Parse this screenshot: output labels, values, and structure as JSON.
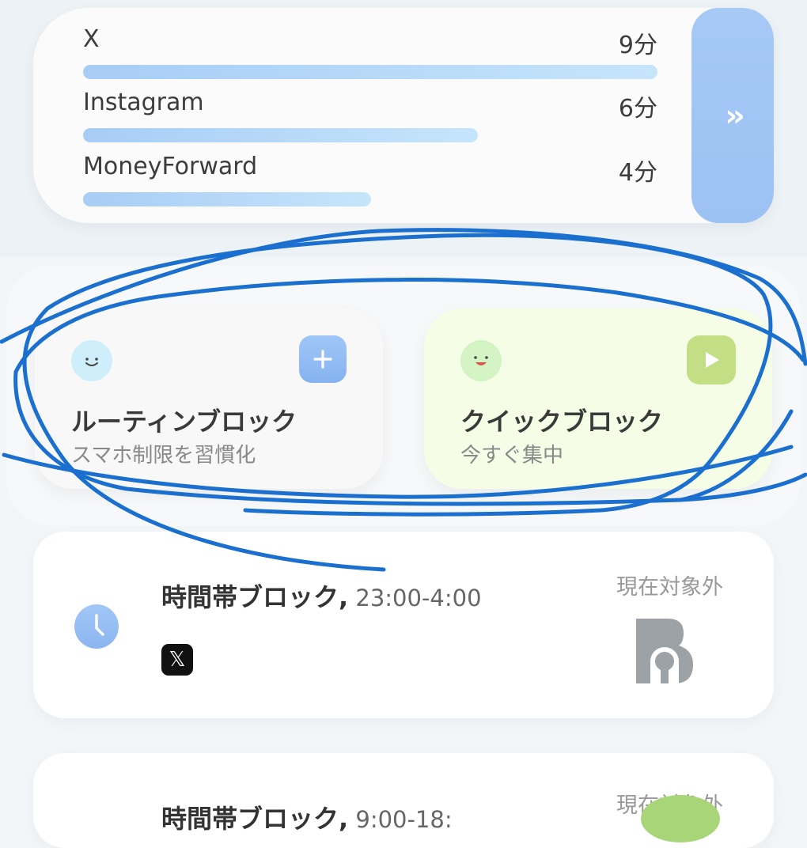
{
  "usage": {
    "items": [
      {
        "name": "X",
        "time": "9分",
        "fraction": 1.0
      },
      {
        "name": "Instagram",
        "time": "6分",
        "fraction": 0.688
      },
      {
        "name": "MoneyForward",
        "time": "4分",
        "fraction": 0.501
      }
    ],
    "more_icon": "double-chevron-right-icon",
    "bar_color": "#a7cdf6"
  },
  "blocks": {
    "routine": {
      "title": "ルーティンブロック",
      "subtitle": "スマホ制限を習慣化",
      "action_icon": "plus-icon",
      "face_icon": "smile-face-icon",
      "color": "#cfeefb"
    },
    "quick": {
      "title": "クイックブロック",
      "subtitle": "今すぐ集中",
      "action_icon": "play-icon",
      "face_icon": "laughing-face-icon",
      "color": "#c3df86"
    }
  },
  "schedules": [
    {
      "title": "時間帯ブロック,",
      "time": " 23:00-4:00",
      "status": "現在対象外",
      "apps": [
        "X"
      ],
      "icon": "clock-icon",
      "lock_icon": "lock-icon"
    },
    {
      "title": "時間帯ブロック,",
      "time": " 9:00-18:",
      "status": "現在対象外"
    }
  ],
  "annotation_color": "#1a6fcf"
}
